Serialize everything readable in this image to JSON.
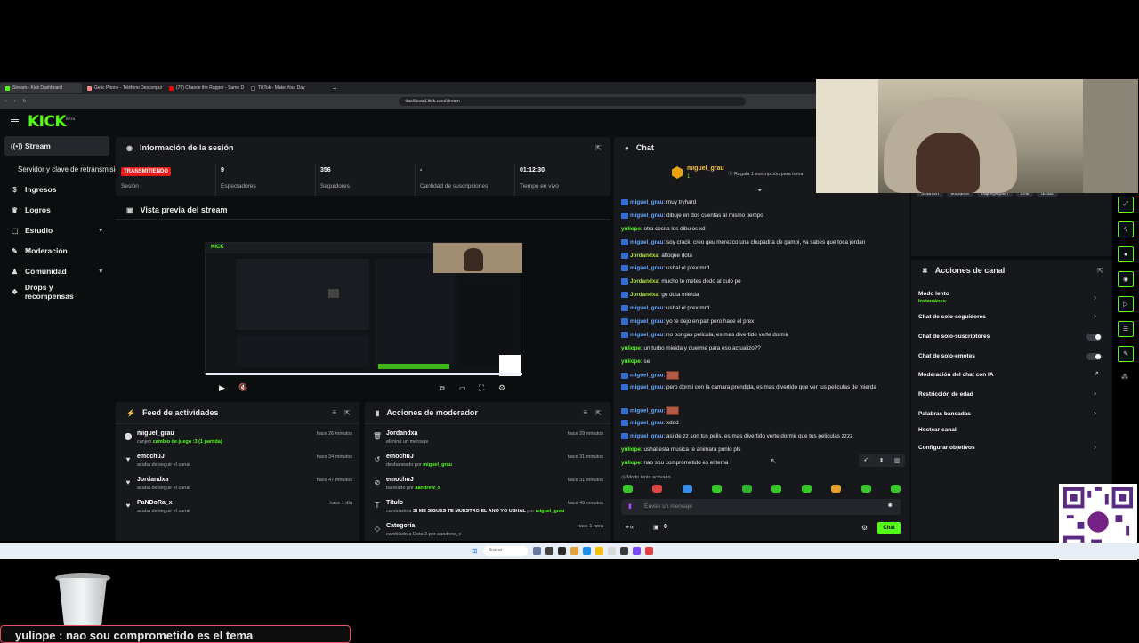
{
  "browser": {
    "tabs": [
      {
        "label": "Stream - Kick Dashboard",
        "active": true
      },
      {
        "label": "Getic Phone - Teléfono Desconpur",
        "active": false
      },
      {
        "label": "(75) Chance the Rapper - Same D",
        "active": false
      },
      {
        "label": "TikTok - Make Your Day",
        "active": false
      }
    ],
    "new_tab": "+",
    "url": "dashboard.kick.com/stream"
  },
  "app": {
    "logo": "KICK",
    "logo_badge": "BETA"
  },
  "sidebar": {
    "items": [
      {
        "label": "Stream",
        "icon": "broadcast-icon",
        "active": true
      },
      {
        "label": "Servidor y clave de retransmisión",
        "sub": true
      },
      {
        "label": "Ingresos",
        "icon": "dollar-icon"
      },
      {
        "label": "Logros",
        "icon": "trophy-icon"
      },
      {
        "label": "Estudio",
        "icon": "studio-icon",
        "chevron": true
      },
      {
        "label": "Moderación",
        "icon": "wrench-icon"
      },
      {
        "label": "Comunidad",
        "icon": "community-icon",
        "chevron": true
      },
      {
        "label": "Drops y recompensas",
        "icon": "gift-icon"
      }
    ]
  },
  "session": {
    "title": "Información de la sesión",
    "live_badge": "TRANSMITIENDO",
    "session_label": "Sesión",
    "stats": [
      {
        "value": "9",
        "label": "Espectadores"
      },
      {
        "value": "356",
        "label": "Seguidores"
      },
      {
        "value": "-",
        "label": "Cantidad de suscripciones"
      },
      {
        "value": "01:12:30",
        "label": "Tiempo en vivo"
      }
    ]
  },
  "preview": {
    "title": "Vista previa del stream"
  },
  "activity": {
    "title": "Feed de actividades",
    "items": [
      {
        "name": "miguel_grau",
        "pre": "canjeó ",
        "highlight": "cambio de juego :3 (1 partida)",
        "time": "hace 26 minutos",
        "icon": "redeem-icon"
      },
      {
        "name": "emochuJ",
        "pre": "acaba de seguir el canal",
        "highlight": "",
        "time": "hace 34 minutos",
        "icon": "heart-icon"
      },
      {
        "name": "Jordandxa",
        "pre": "acaba de seguir el canal",
        "highlight": "",
        "time": "hace 47 minutos",
        "icon": "heart-icon"
      },
      {
        "name": "PaNDoRa_x",
        "pre": "acaba de seguir el canal",
        "highlight": "",
        "time": "hace 1 día",
        "icon": "heart-icon"
      }
    ]
  },
  "modactions": {
    "title": "Acciones de moderador",
    "items": [
      {
        "name": "Jordandxa",
        "pre": "eliminó un mensaje",
        "by_pre": "",
        "by": "",
        "time": "hace 29 minutos",
        "icon": "trash-icon"
      },
      {
        "name": "emochuJ",
        "pre": "desbaneado por ",
        "by_pre": "",
        "by": "miguel_grau",
        "time": "hace 31 minutos",
        "icon": "unban-icon"
      },
      {
        "name": "emochuJ",
        "pre": "baneado por ",
        "by_pre": "",
        "by": "aandrew_x",
        "time": "hace 31 minutos",
        "icon": "ban-icon"
      },
      {
        "name": "Título",
        "pre": "cambiado a ",
        "by_pre": "SI ME SIGUES TE MUESTRO EL ANO YO USHAL",
        "by": "miguel_grau",
        "time": "hace 49 minutos",
        "icon": "title-icon"
      },
      {
        "name": "Categoría",
        "pre": "cambiado a Dota 2 por aandrew_x",
        "by_pre": "",
        "by": "",
        "time": "hace 1 hora",
        "icon": "category-icon"
      }
    ]
  },
  "chat": {
    "title": "Chat",
    "pinned_user": "miguel_grau",
    "pinned_count": "1",
    "pinned_gift": "Regala 1 suscripción para toma",
    "tags": [
      "Spanish",
      "Español",
      "bajoepepian",
      "chill",
      "dota2"
    ],
    "messages": [
      {
        "user": "miguel_grau",
        "cls": "u1",
        "badge": true,
        "text": "muy tryhard"
      },
      {
        "user": "miguel_grau",
        "cls": "u1",
        "badge": true,
        "text": "dibuje en dos cuentas al mismo tiempo"
      },
      {
        "user": "yuliope",
        "cls": "u3",
        "badge": false,
        "text": "otra cosita los dibujos xd"
      },
      {
        "user": "miguel_grau",
        "cls": "u1",
        "badge": true,
        "text": "soy crack, creo qeu merezco una chupadita de gampi, ya sabes que toca jordan"
      },
      {
        "user": "Jordandxa",
        "cls": "u2",
        "badge": true,
        "text": "altoque dota"
      },
      {
        "user": "miguel_grau",
        "cls": "u1",
        "badge": true,
        "text": "ushal el prex mrd"
      },
      {
        "user": "Jordandxa",
        "cls": "u2",
        "badge": true,
        "text": "mucho te metes dedo al culo pe"
      },
      {
        "user": "Jordandxa",
        "cls": "u2",
        "badge": true,
        "text": "go dota mierda"
      },
      {
        "user": "miguel_grau",
        "cls": "u1",
        "badge": true,
        "text": "ushal el prex mrd"
      },
      {
        "user": "miguel_grau",
        "cls": "u1",
        "badge": true,
        "text": "yo te dejo en paz pero hace el prex"
      },
      {
        "user": "miguel_grau",
        "cls": "u1",
        "badge": true,
        "text": "no pongas pelicula, es mas divertido verte dormir"
      },
      {
        "user": "yuliope",
        "cls": "u3",
        "badge": false,
        "text": "un turbo mieida y duerme para eso actualizo??"
      },
      {
        "user": "yuliope",
        "cls": "u3",
        "badge": false,
        "text": "se"
      },
      {
        "user": "miguel_grau",
        "cls": "u1",
        "badge": true,
        "text": "",
        "emote": true
      },
      {
        "user": "miguel_grau",
        "cls": "u1",
        "badge": true,
        "text": "pero dormi con la camara prendida, es mas divertido que ver tus peliculas de mierda",
        "wrap": true
      },
      {
        "user": "miguel_grau",
        "cls": "u1",
        "badge": true,
        "text": "",
        "emote": true
      },
      {
        "user": "miguel_grau",
        "cls": "u1",
        "badge": true,
        "text": "xddd"
      },
      {
        "user": "miguel_grau",
        "cls": "u1",
        "badge": true,
        "text": "asi de zz son tus pelis, es mas divertido verte dormir que tus peliculas zzzz"
      },
      {
        "user": "yuliope",
        "cls": "u3",
        "badge": false,
        "text": "ushal esta musica te animara ponlo pls"
      },
      {
        "user": "yuliope",
        "cls": "u3",
        "badge": false,
        "text": "nao sou comprometido es el tema"
      }
    ],
    "slow_mode_note": "Modo lento activado",
    "input_placeholder": "Enviar un mensaje",
    "points": "0",
    "send_label": "Chat"
  },
  "channel_actions": {
    "title": "Acciones de canal",
    "items": [
      {
        "label": "Modo lento",
        "sub": "Instantáneo",
        "control": "arrow"
      },
      {
        "label": "Chat de solo-seguidores",
        "control": "arrow"
      },
      {
        "label": "Chat de solo-suscriptores",
        "control": "toggle"
      },
      {
        "label": "Chat de solo-emotes",
        "control": "toggle"
      },
      {
        "label": "Moderación del chat con IA",
        "control": "external"
      },
      {
        "label": "Restricción de edad",
        "control": "arrow"
      },
      {
        "label": "Palabras baneadas",
        "control": "arrow"
      },
      {
        "label": "Hostear canal",
        "control": "none"
      },
      {
        "label": "Configurar objetivos",
        "control": "arrow"
      }
    ]
  },
  "taskbar": {
    "search": "Buscar"
  },
  "overlay": {
    "caption": "yuliope : nao sou comprometido es el tema"
  },
  "colors": {
    "accent": "#53fc18",
    "live": "#e91916",
    "panel": "#16181c",
    "bg": "#0b0e0f"
  }
}
